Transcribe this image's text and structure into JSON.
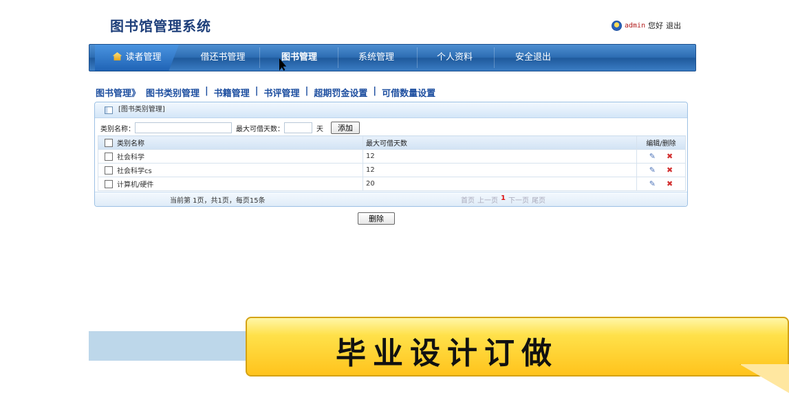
{
  "header": {
    "title": "图书馆管理系统",
    "user": "admin",
    "greeting": "您好",
    "logout": "退出"
  },
  "nav": {
    "items": [
      {
        "label": "读者管理"
      },
      {
        "label": "借还书管理"
      },
      {
        "label": "图书管理"
      },
      {
        "label": "系统管理"
      },
      {
        "label": "个人资料"
      },
      {
        "label": "安全退出"
      }
    ]
  },
  "breadcrumb": {
    "root": "图书管理》",
    "links": [
      "图书类别管理",
      "书籍管理",
      "书评管理",
      "超期罚金设置",
      "可借数量设置"
    ],
    "sep": "|"
  },
  "panel": {
    "title": "[图书类别管理]",
    "form": {
      "name_label": "类别名称：",
      "name_value": "",
      "days_label": "最大可借天数：",
      "days_value": "",
      "days_unit": "天",
      "add_button": "添加"
    },
    "columns": [
      "类别名称",
      "最大可借天数",
      "编辑/删除"
    ],
    "rows": [
      {
        "name": "社会科学",
        "days": "12"
      },
      {
        "name": "社会科学cs",
        "days": "12"
      },
      {
        "name": "计算机/硬件",
        "days": "20"
      }
    ],
    "pager": {
      "info": "当前第 1页，共1页，每页15条",
      "first": "首页",
      "prev": "上一页",
      "current": "1",
      "next": "下一页",
      "last": "尾页"
    }
  },
  "delete_button": "删除",
  "banner": {
    "text": "毕业设计订做"
  },
  "colors": {
    "nav": "#2d6db3",
    "banner": "#ffd23a",
    "link": "#1e4fa0"
  }
}
